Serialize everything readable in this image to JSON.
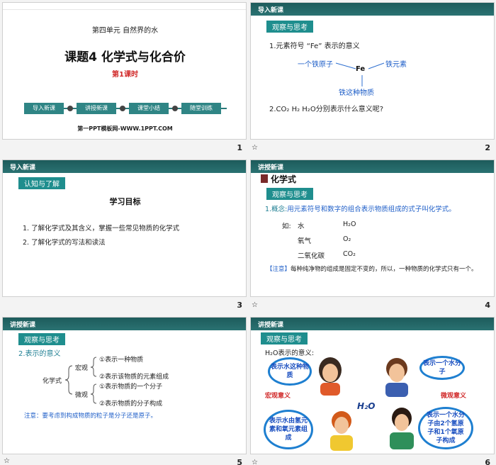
{
  "slides": [
    {
      "number": "1",
      "unit": "第四单元 自然界的水",
      "title": "课题4  化学式与化合价",
      "subtitle": "第1课时",
      "nav": [
        "导入新课",
        "讲授新课",
        "课堂小结",
        "随堂训练"
      ],
      "site": "第一PPT模板网-WWW.1PPT.COM"
    },
    {
      "number": "2",
      "header": "导入新课",
      "tag": "观察与思考",
      "q1": "1.元素符号 “Fe” 表示的意义",
      "center": "Fe",
      "left": "一个铁原子",
      "right": "铁元素",
      "bottom": "铁这种物质",
      "q2": "2.CO₂   H₂   H₂O分别表示什么意义呢?"
    },
    {
      "number": "3",
      "header": "导入新课",
      "tag": "认知与了解",
      "heading": "学习目标",
      "goals": [
        "1. 了解化学式及其含义，掌握一些常见物质的化学式",
        "2. 了解化学式的写法和读法"
      ]
    },
    {
      "number": "4",
      "header": "讲授新课",
      "section": "化学式",
      "tag": "观察与思考",
      "concept_label": "1.概念:",
      "concept_text": "用元素符号和数字的组合表示物质组成的式子叫化学式。",
      "examples_prefix": "如:",
      "examples": [
        {
          "name": "水",
          "formula": "H₂O"
        },
        {
          "name": "氧气",
          "formula": "O₂"
        },
        {
          "name": "二氧化碳",
          "formula": "CO₂"
        }
      ],
      "note_label": "【注意】",
      "note_text": "每种纯净物的组成是固定不变的，所以，一种物质的化学式只有一个。"
    },
    {
      "number": "5",
      "header": "讲授新课",
      "tag": "观察与思考",
      "heading": "2.表示的意义",
      "root": "化学式",
      "macro": "宏观",
      "micro": "微观",
      "items": [
        "①表示一种物质",
        "②表示该物质的元素组成",
        "①表示物质的一个分子",
        "②表示物质的分子构成"
      ],
      "note": "注意：要考虑到构成物质的粒子是分子还是原子。"
    },
    {
      "number": "6",
      "header": "讲授新课",
      "tag": "观察与思考",
      "heading": "H₂O表示的意义:",
      "center_formula": "H₂O",
      "macro_label": "宏观意义",
      "micro_label": "微观意义",
      "bubbles": [
        "表示水这种物质",
        "表示一个水分子",
        "表示水由氢元素和氧元素组成",
        "表示一个水分子由2个氢原子和1个氧原子构成"
      ]
    }
  ],
  "footer_icon": "star-icon",
  "colors": {
    "teal": "#1f8e8e",
    "header": "#1d5b5b",
    "red": "#d12a2a",
    "blue": "#1e7fd0"
  }
}
